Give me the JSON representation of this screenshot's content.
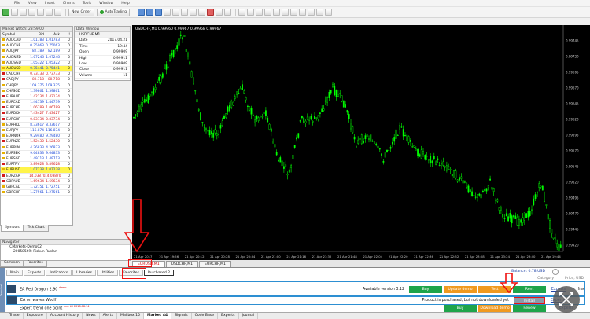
{
  "menu": [
    "File",
    "View",
    "Insert",
    "Charts",
    "Tools",
    "Window",
    "Help"
  ],
  "toolbar": {
    "new_order": "New Order",
    "autotrading": "AutoTrading"
  },
  "market_watch": {
    "title": "Market Watch: 23:59:00",
    "columns": [
      "Symbol",
      "Bid",
      "Ask",
      "!"
    ],
    "rows": [
      {
        "s": "AUDCAD",
        "b": "1.01783",
        "a": "1.01783",
        "sp": "0",
        "d": "up"
      },
      {
        "s": "AUDCHF",
        "b": "0.75063",
        "a": "0.75063",
        "sp": "0",
        "d": "up"
      },
      {
        "s": "AUDJPY",
        "b": "82.189",
        "a": "82.189",
        "sp": "0",
        "d": "up"
      },
      {
        "s": "AUDNZD",
        "b": "1.07248",
        "a": "1.07248",
        "sp": "0",
        "d": "up"
      },
      {
        "s": "AUDSGD",
        "b": "1.05322",
        "a": "1.05322",
        "sp": "0",
        "d": "up"
      },
      {
        "s": "AUDUSD",
        "b": "0.75441",
        "a": "0.75441",
        "sp": "0",
        "d": "up",
        "hl": true
      },
      {
        "s": "CADCHF",
        "b": "0.73733",
        "a": "0.73733",
        "sp": "0",
        "d": "dn"
      },
      {
        "s": "CADJPY",
        "b": "80.718",
        "a": "80.718",
        "sp": "0",
        "d": "dn"
      },
      {
        "s": "CHFJPY",
        "b": "109.375",
        "a": "109.375",
        "sp": "0",
        "d": "up"
      },
      {
        "s": "CHFSGD",
        "b": "1.39861",
        "a": "1.39861",
        "sp": "0",
        "d": "up"
      },
      {
        "s": "EURAUD",
        "b": "1.42134",
        "a": "1.42134",
        "sp": "0",
        "d": "dn"
      },
      {
        "s": "EURCAD",
        "b": "1.44739",
        "a": "1.44739",
        "sp": "0",
        "d": "up"
      },
      {
        "s": "EURCHF",
        "b": "1.06789",
        "a": "1.06789",
        "sp": "0",
        "d": "dn"
      },
      {
        "s": "EURDKK",
        "b": "7.43427",
        "a": "7.43427",
        "sp": "0",
        "d": "dn"
      },
      {
        "s": "EURGBP",
        "b": "0.83734",
        "a": "0.83734",
        "sp": "0",
        "d": "dn"
      },
      {
        "s": "EURHKD",
        "b": "8.33617",
        "a": "8.33617",
        "sp": "0",
        "d": "up"
      },
      {
        "s": "EURJPY",
        "b": "116.874",
        "a": "116.874",
        "sp": "0",
        "d": "up"
      },
      {
        "s": "EURNOK",
        "b": "9.29480",
        "a": "9.29480",
        "sp": "0",
        "d": "up"
      },
      {
        "s": "EURNZD",
        "b": "1.52430",
        "a": "1.52430",
        "sp": "0",
        "d": "dn"
      },
      {
        "s": "EURPLN",
        "b": "4.26833",
        "a": "4.26833",
        "sp": "0",
        "d": "up"
      },
      {
        "s": "EURSEK",
        "b": "9.64833",
        "a": "9.64833",
        "sp": "0",
        "d": "up"
      },
      {
        "s": "EURSGD",
        "b": "1.49713",
        "a": "1.49713",
        "sp": "0",
        "d": "up"
      },
      {
        "s": "EURTRY",
        "b": "3.89628",
        "a": "3.89628",
        "sp": "0",
        "d": "dn"
      },
      {
        "s": "EURUSD",
        "b": "1.07238",
        "a": "1.07238",
        "sp": "0",
        "d": "up",
        "hl": true
      },
      {
        "s": "EURZAR",
        "b": "14.03870",
        "a": "14.03870",
        "sp": "0",
        "d": "dn"
      },
      {
        "s": "GBPAUD",
        "b": "1.69634",
        "a": "1.69634",
        "sp": "0",
        "d": "dn"
      },
      {
        "s": "GBPCAD",
        "b": "1.72751",
        "a": "1.72751",
        "sp": "0",
        "d": "up"
      },
      {
        "s": "GBPCHF",
        "b": "1.27561",
        "a": "1.27561",
        "sp": "0",
        "d": "up"
      }
    ],
    "tabs": [
      "Symbols",
      "Tick Chart"
    ]
  },
  "data_window": {
    "title": "Data Window",
    "symbol": "USDCHF,M1",
    "rows": [
      {
        "k": "Date",
        "v": "2017.04.21"
      },
      {
        "k": "Time",
        "v": "19:44"
      },
      {
        "k": "Open",
        "v": "0.99909"
      },
      {
        "k": "High",
        "v": "0.99911"
      },
      {
        "k": "Low",
        "v": "0.99909"
      },
      {
        "k": "Close",
        "v": "0.99911"
      },
      {
        "k": "Volume",
        "v": "11"
      }
    ]
  },
  "navigator": {
    "title": "Navigator",
    "lines": [
      "ICMarkets-Demo02",
      "20058569: Pishun Ruslan"
    ],
    "tabs": [
      "Common",
      "Favorites"
    ]
  },
  "chart": {
    "header": "USDCHF,M1  0.99960 0.99967 0.99958 0.99967",
    "price_labels": [
      "0.99745",
      "0.99720",
      "0.99695",
      "0.99670",
      "0.99645",
      "0.99620",
      "0.99595",
      "0.99570",
      "0.99545",
      "0.99520",
      "0.99495",
      "0.99470",
      "0.99445",
      "0.99420"
    ],
    "time_labels": [
      "21 Apr 2017",
      "21 Apr 19:56",
      "21 Apr 20:12",
      "21 Apr 20:28",
      "21 Apr 20:44",
      "21 Apr 21:00",
      "21 Apr 21:16",
      "21 Apr 21:32",
      "21 Apr 21:48",
      "21 Apr 22:04",
      "21 Apr 22:20",
      "21 Apr 22:36",
      "21 Apr 22:52",
      "21 Apr 23:08",
      "21 Apr 23:24",
      "21 Apr 23:40",
      "21 Apr 19:44"
    ],
    "tabs": [
      "EURUSD,M1",
      "USDCHF,M1",
      "EURCHF,M1"
    ],
    "active_tab": 0
  },
  "market": {
    "tabs": [
      "Main",
      "Experts",
      "Indicators",
      "Libraries",
      "Utilities",
      "Favorites",
      "Purchased"
    ],
    "purchased_count": "2",
    "active_tab": 6,
    "balance": "Balance: 0.78 USD",
    "columns": [
      "Category",
      "Price, USD"
    ],
    "products": [
      {
        "name": "EA Red Dragon",
        "ver_short": "2.90",
        "badge": "demo",
        "status": "Available version 3.12",
        "b1": "Buy",
        "b2": "Update demo",
        "b3": "Test",
        "b4": "Rent",
        "cat": "Experts",
        "price": "free"
      },
      {
        "name": "EA on waves Woolf",
        "ver_short": "",
        "badge": "",
        "status": "Product is purchased, but not downloaded yet",
        "b1": "",
        "b2": "",
        "b3": "",
        "b4": "Install",
        "cat": "Experts",
        "price": ""
      },
      {
        "name": "Expert trend one point",
        "ver_short": "",
        "badge": "rent till 2018.08.14",
        "status": "",
        "b1": "Buy",
        "b2": "Download demo",
        "b3": "",
        "b4": "Renew",
        "cat": "Experts",
        "price": ""
      }
    ]
  },
  "side_label": "Terminal",
  "bottom_tabs": [
    "Trade",
    "Exposure",
    "Account History",
    "News",
    "Alerts",
    "Mailbox",
    "Market",
    "Signals",
    "Code Base",
    "Experts",
    "Journal"
  ],
  "bottom_counts": {
    "Mailbox": "15",
    "Market": "44"
  },
  "active_bottom": "Market",
  "colors": {
    "candle": "#00ff00",
    "chart_bg": "#000000",
    "selected_border": "#2d8fd2",
    "annotation": "#e11111"
  }
}
